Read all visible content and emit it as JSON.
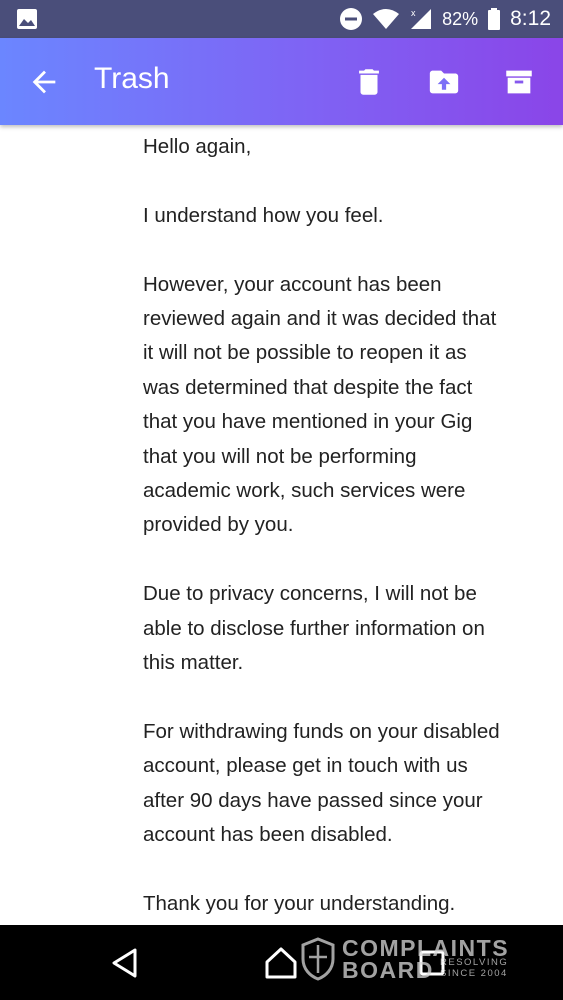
{
  "status_bar": {
    "battery": "82%",
    "time": "8:12",
    "icons": [
      "image-notification-icon",
      "dnd-icon",
      "wifi-icon",
      "signal-icon",
      "battery-icon"
    ]
  },
  "app_bar": {
    "title": "Trash",
    "icons": [
      "back-arrow-icon",
      "delete-icon",
      "move-to-inbox-icon",
      "archive-icon"
    ]
  },
  "message": {
    "paragraphs": [
      "Hello again,",
      "I understand how you feel.",
      "However, your account has been\nreviewed again and it was decided that\nit will not be possible to reopen it as\nwas determined that despite the fact\nthat you have mentioned in your Gig\nthat you will not be performing\nacademic work, such services were\nprovided by you.",
      "Due to privacy concerns, I will not be\nable to disclose further information on\nthis matter.",
      "For withdrawing funds on your disabled\naccount, please get in touch with us\nafter 90 days have passed since your\naccount has been disabled.",
      "Thank you for your understanding."
    ]
  },
  "watermark": {
    "line1": "COMPLAINTS",
    "line2": "BOARD",
    "line3a": "RESOLVING",
    "line3b": "SINCE 2004"
  },
  "nav_bar": {
    "icons": [
      "back-triangle-icon",
      "home-icon",
      "recents-icon"
    ]
  },
  "colors": {
    "status_bar": "#4a4e7a",
    "app_bar_start": "#6b86ff",
    "app_bar_end": "#8a45e8",
    "text": "#222222",
    "nav_bar": "#000000"
  }
}
